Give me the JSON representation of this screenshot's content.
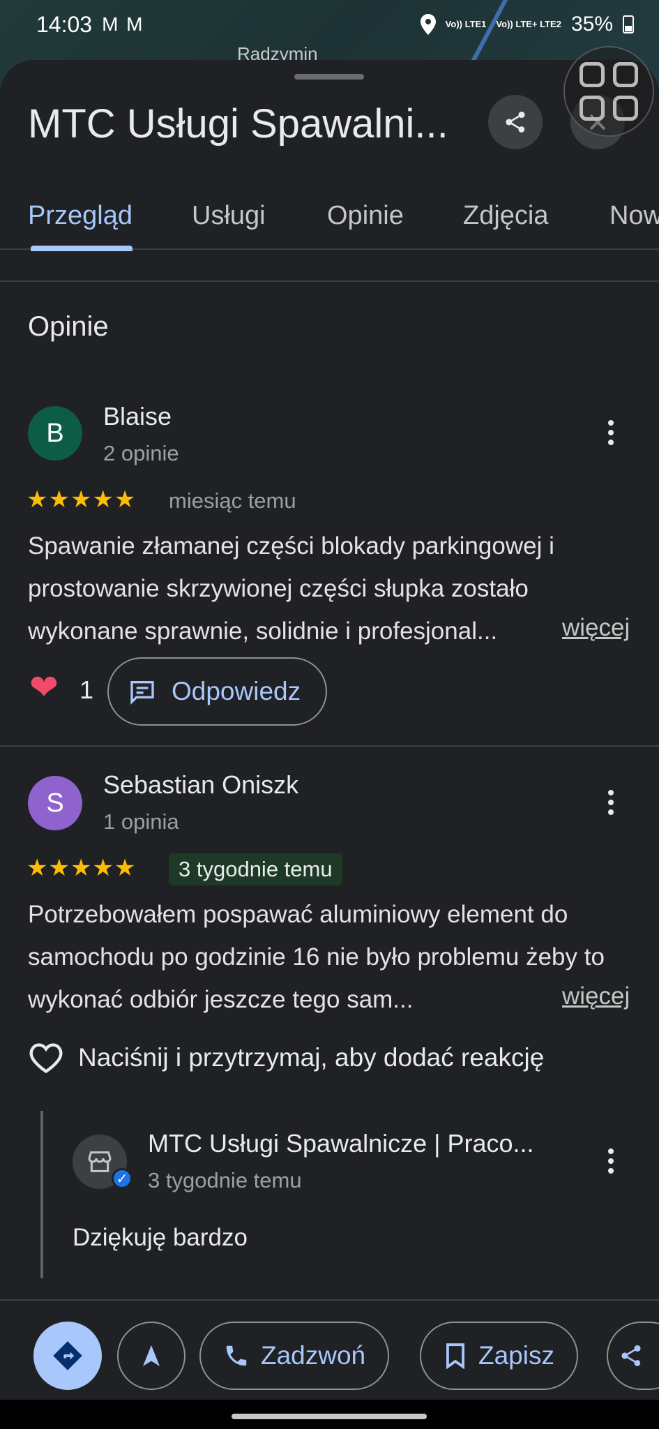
{
  "status_bar": {
    "time": "14:03",
    "mail_icons": "M M",
    "net1": "Vo)) LTE1",
    "net2": "Vo)) LTE+ LTE2",
    "battery": "35%"
  },
  "map": {
    "place": "Radzymin"
  },
  "header": {
    "title": "MTC Usługi Spawalni..."
  },
  "tabs": [
    {
      "label": "Przegląd",
      "active": true
    },
    {
      "label": "Usługi"
    },
    {
      "label": "Opinie"
    },
    {
      "label": "Zdjęcia"
    },
    {
      "label": "Now"
    }
  ],
  "section_title": "Opinie",
  "reviews": [
    {
      "initial": "B",
      "avatar_color": "#0d5c46",
      "name": "Blaise",
      "count": "2 opinie",
      "stars": "★★★★★",
      "rating": 5,
      "time": "miesiąc temu",
      "text": "Spawanie złamanej części blokady parkingowej i prostowanie skrzywionej części słupka zostało wykonane sprawnie, solidnie i profesjonal...",
      "more": "więcej",
      "likes": "1",
      "reply_label": "Odpowiedz"
    },
    {
      "initial": "S",
      "avatar_color": "#8e63ce",
      "name": "Sebastian Oniszk",
      "count": "1 opinia",
      "stars": "★★★★★",
      "rating": 5,
      "time": "3 tygodnie temu",
      "text": "Potrzebowałem  pospawać aluminiowy element do samochodu po godzinie 16 nie było problemu żeby to wykonać odbiór jeszcze tego sam...",
      "more": "więcej",
      "react_hint": "Naciśnij i przytrzymaj, aby dodać reakcję",
      "owner_reply": {
        "name": "MTC Usługi Spawalnicze | Praco...",
        "time": "3 tygodnie temu",
        "text": "Dziękuję bardzo"
      }
    }
  ],
  "actions": {
    "call": "Zadzwoń",
    "save": "Zapisz"
  },
  "colors": {
    "accent": "#a8c7fa",
    "star": "#fbbc04",
    "sheet_bg": "#202124"
  }
}
